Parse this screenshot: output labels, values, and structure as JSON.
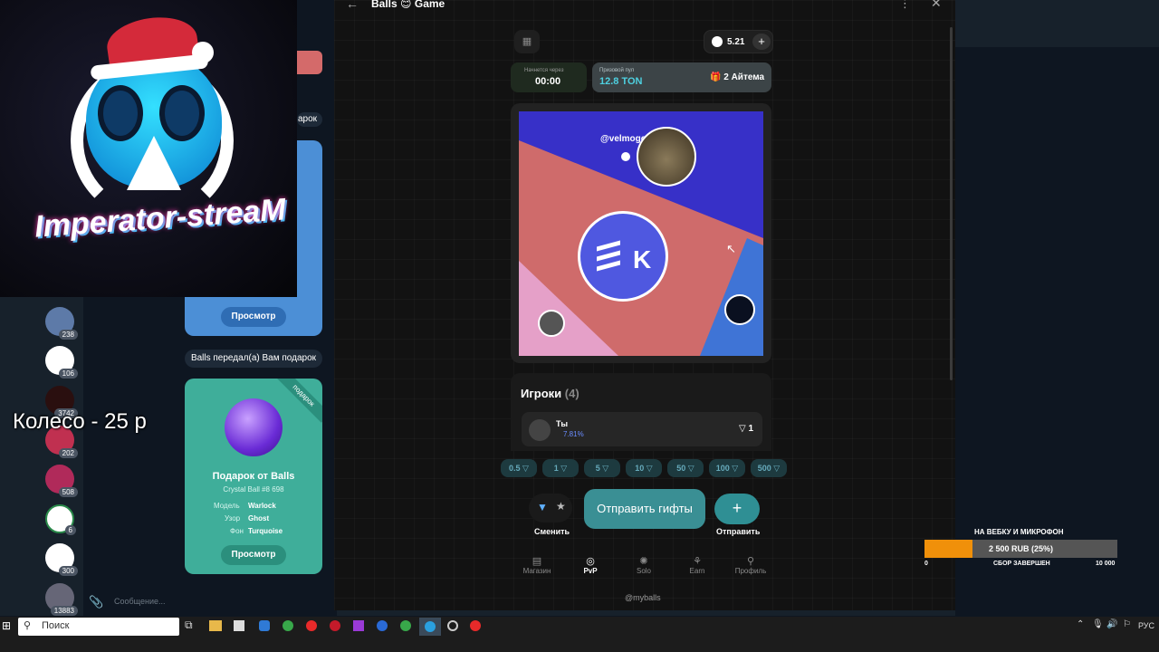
{
  "app": {
    "title": "Balls 😊 Game",
    "balance": "5.21",
    "start_label": "Начнется через",
    "start_time": "00:00",
    "prize_label": "Призовой пул",
    "prize_value": "12.8 TON",
    "items": "2 Айтема",
    "player_tag": "@velmogoat",
    "players_label": "Игроки",
    "players_count": "(4)",
    "me_label": "Ты",
    "me_percent": "7.81%",
    "me_value": "1",
    "amounts": [
      "0.5",
      "1",
      "5",
      "10",
      "50",
      "100",
      "500"
    ],
    "change_label": "Сменить",
    "send_gifts_label": "Отправить гифты",
    "send_label": "Отправить",
    "tabs": [
      "Магазин",
      "PvP",
      "Solo",
      "Earn",
      "Профиль"
    ],
    "footer": "@myballs",
    "center_logo_text": "K"
  },
  "chat": {
    "view_label": "Просмотр",
    "message": "Balls передал(а) Вам подарок",
    "gift_title": "Подарок от Balls",
    "gift_sub": "Crystal Ball #8 698",
    "model_label": "Модель",
    "model_value": "Warlock",
    "pattern_label": "Узор",
    "pattern_value": "Ghost",
    "bg_label": "Фон",
    "bg_value": "Turquoise",
    "ribbon": "подарок",
    "partial_text": "арок",
    "input_placeholder": "Сообщение..."
  },
  "rail_counts": [
    "238",
    "106",
    "3742",
    "202",
    "508",
    "6",
    "300",
    "13883"
  ],
  "overlay": {
    "wheel_text": "Колесо - 25 р",
    "logo_text": "Imperator-streaM"
  },
  "donation": {
    "title": "НА ВЕБКУ И МИКРОФОН",
    "amount": "2 500 RUB (25%)",
    "min": "0",
    "status": "СБОР ЗАВЕРШЕН",
    "max": "10 000"
  },
  "taskbar": {
    "search": "Поиск",
    "lang": "РУС"
  },
  "colors": {
    "accent_teal": "#3ab0b0",
    "wedge_blue": "#3730c8",
    "wedge_red": "#cf6b6b",
    "wedge_pink": "#e5a0c8",
    "wedge_lightblue": "#3f74d6",
    "gift_card_green": "#3fae9a",
    "donation_orange": "#f0900a"
  }
}
